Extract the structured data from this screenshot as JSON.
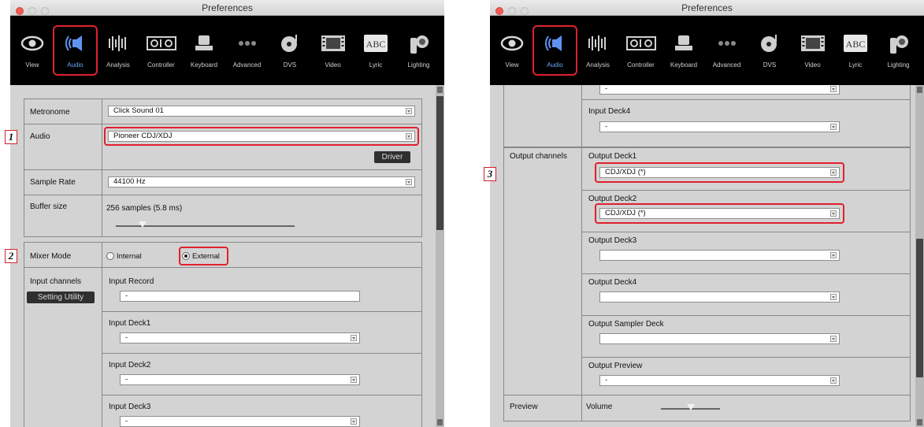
{
  "window_title": "Preferences",
  "colors": {
    "highlight": "#e0202e",
    "active_tab": "#6fa3ff",
    "toolbar_bg": "#000000"
  },
  "toolbar": {
    "items": [
      {
        "label": "View",
        "icon": "eye-icon"
      },
      {
        "label": "Audio",
        "icon": "speaker-icon",
        "active": true
      },
      {
        "label": "Analysis",
        "icon": "waveform-icon"
      },
      {
        "label": "Controller",
        "icon": "controller-icon"
      },
      {
        "label": "Keyboard",
        "icon": "keyboard-icon"
      },
      {
        "label": "Advanced",
        "icon": "dots-icon"
      },
      {
        "label": "DVS",
        "icon": "record-icon"
      },
      {
        "label": "Video",
        "icon": "film-icon"
      },
      {
        "label": "Lyric",
        "icon": "abc-icon"
      },
      {
        "label": "Lighting",
        "icon": "light-icon"
      }
    ]
  },
  "left": {
    "metronome": {
      "label": "Metronome",
      "value": "Click Sound 01"
    },
    "audio": {
      "label": "Audio",
      "value": "Pioneer CDJ/XDJ",
      "driver_button": "Driver"
    },
    "sample_rate": {
      "label": "Sample Rate",
      "value": "44100 Hz"
    },
    "buffer_size": {
      "label": "Buffer size",
      "value": "256 samples (5.8 ms)",
      "slider_position": 0.15
    },
    "mixer_mode": {
      "label": "Mixer Mode",
      "option_internal": "Internal",
      "option_external": "External",
      "selected": "External"
    },
    "input_channels": {
      "label": "Input channels",
      "setting_utility": "Setting Utility",
      "input_record": {
        "label": "Input Record",
        "value": "-"
      },
      "decks": [
        {
          "label": "Input Deck1",
          "value": "-"
        },
        {
          "label": "Input Deck2",
          "value": "-"
        },
        {
          "label": "Input Deck3",
          "value": "-"
        }
      ]
    },
    "badges": [
      "1",
      "2"
    ]
  },
  "right": {
    "input_deck3_value": "-",
    "input_deck4": {
      "label": "Input Deck4",
      "value": "-"
    },
    "output_channels": {
      "label": "Output channels",
      "items": [
        {
          "label": "Output Deck1",
          "value": "CDJ/XDJ (*)"
        },
        {
          "label": "Output Deck2",
          "value": "CDJ/XDJ (*)"
        },
        {
          "label": "Output Deck3",
          "value": ""
        },
        {
          "label": "Output Deck4",
          "value": ""
        },
        {
          "label": "Output Sampler Deck",
          "value": ""
        },
        {
          "label": "Output Preview",
          "value": "-"
        }
      ]
    },
    "preview": {
      "label": "Preview",
      "volume_label": "Volume",
      "slider_position": 0.5
    },
    "badge": "3"
  }
}
